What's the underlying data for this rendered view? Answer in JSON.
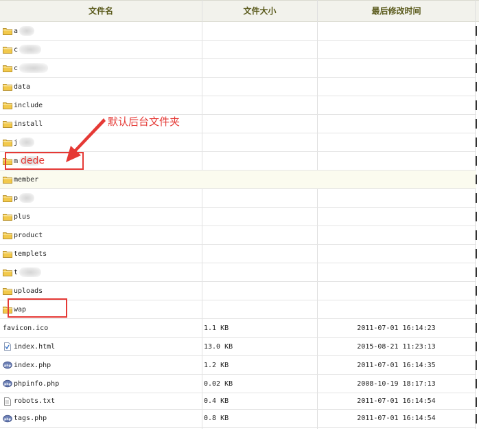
{
  "header": {
    "col_name": "文件名",
    "col_size": "文件大小",
    "col_time": "最后修改时间"
  },
  "rows": [
    {
      "name": "a",
      "type": "folder",
      "blurred": true
    },
    {
      "name": "c",
      "type": "folder",
      "blurred": true
    },
    {
      "name": "c",
      "type": "folder",
      "blurred": true
    },
    {
      "name": "data",
      "type": "folder"
    },
    {
      "name": "include",
      "type": "folder"
    },
    {
      "name": "install",
      "type": "folder"
    },
    {
      "name": "j",
      "type": "folder",
      "blurred": true
    },
    {
      "name": "m",
      "type": "folder",
      "blurred": true
    },
    {
      "name": "member",
      "type": "folder",
      "highlight": true
    },
    {
      "name": "p",
      "type": "folder",
      "blurred": true
    },
    {
      "name": "plus",
      "type": "folder"
    },
    {
      "name": "product",
      "type": "folder"
    },
    {
      "name": "templets",
      "type": "folder"
    },
    {
      "name": "t",
      "type": "folder",
      "blurred": true
    },
    {
      "name": "uploads",
      "type": "folder"
    },
    {
      "name": "wap",
      "type": "folder"
    },
    {
      "name": "favicon.ico",
      "type": "none",
      "size": "1.1 KB",
      "time": "2011-07-01 16:14:23"
    },
    {
      "name": "index.html",
      "type": "html",
      "size": "13.0 KB",
      "time": "2015-08-21 11:23:13"
    },
    {
      "name": "index.php",
      "type": "php",
      "size": "1.2 KB",
      "time": "2011-07-01 16:14:35"
    },
    {
      "name": "phpinfo.php",
      "type": "php",
      "size": "0.02 KB",
      "time": "2008-10-19 18:17:13"
    },
    {
      "name": "robots.txt",
      "type": "txt",
      "size": "0.4 KB",
      "time": "2011-07-01 16:14:54"
    },
    {
      "name": "tags.php",
      "type": "php",
      "size": "0.8 KB",
      "time": "2011-07-01 16:14:54"
    }
  ],
  "annotations": {
    "label": "默认后台文件夹",
    "dede_text": "dede"
  },
  "colors": {
    "header_bg": "#f2f2ec",
    "header_text": "#5a5a1c",
    "highlight_row": "#fbfbef",
    "annotation": "#e53935",
    "folder": "#f2c94c"
  }
}
